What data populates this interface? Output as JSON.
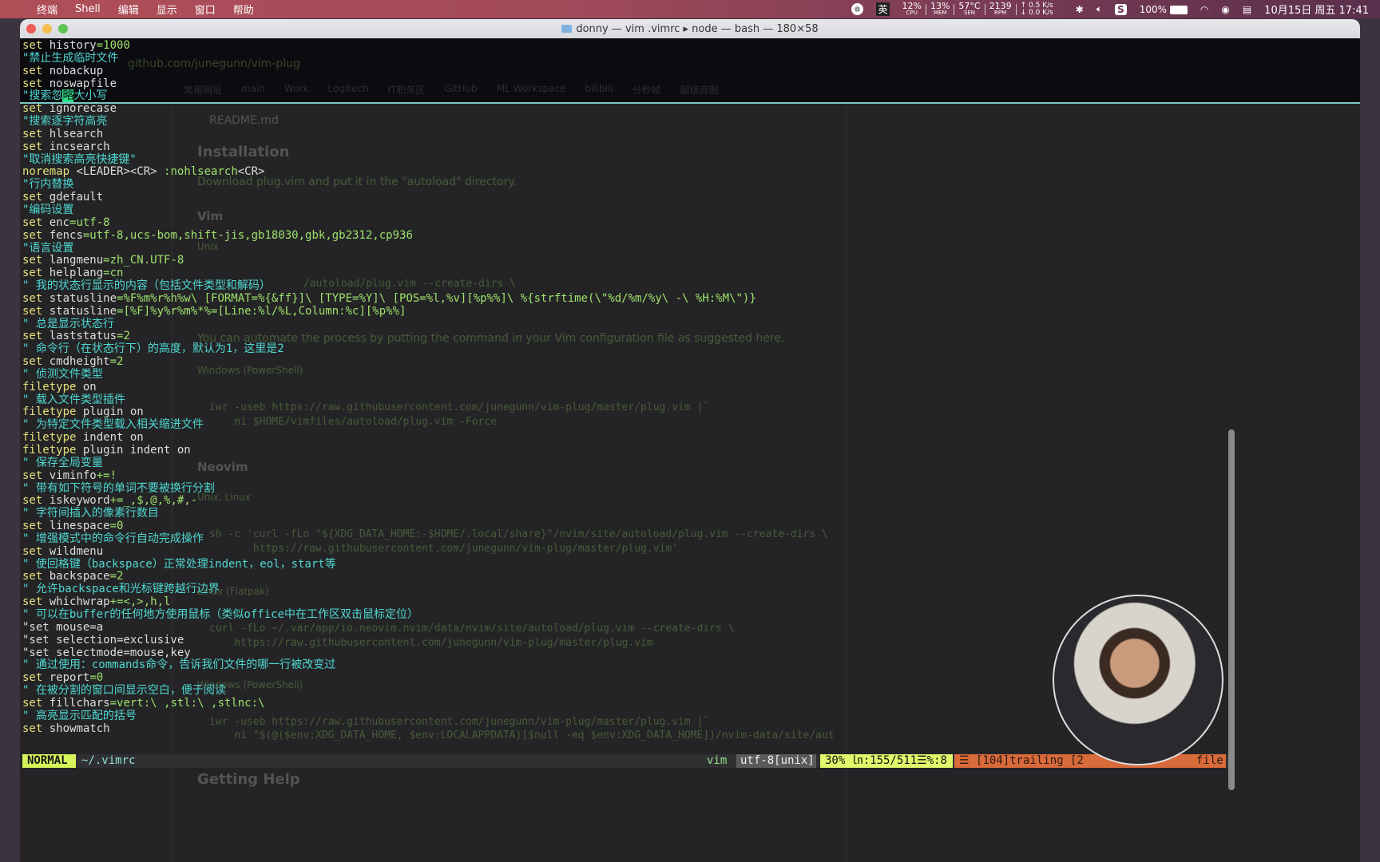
{
  "menubar": {
    "apple": "",
    "items": [
      "终端",
      "Shell",
      "编辑",
      "显示",
      "窗口",
      "帮助"
    ],
    "status": {
      "input_method": "英",
      "cpu": "12%",
      "cpu_label": "CPU",
      "mem": "13%",
      "mem_label": "MEM",
      "sen": "57°C",
      "sen_label": "SEN",
      "rpm": "2139",
      "rpm_label": "RPM",
      "up": "↑ 0.5 K/s",
      "down": "↓ 0.0 K/s",
      "battery": "100%",
      "datetime": "10月15日 周五 17:41"
    }
  },
  "window": {
    "title": "donny — vim .vimrc ▸ node — bash — 180×58"
  },
  "colors": {
    "normal_mode": "#d7f55a",
    "progress": "#e2f76a",
    "warning": "#d96a3a",
    "comment": "#4fd8d2",
    "keyword": "#e6e07c",
    "value": "#9fe36b"
  },
  "background_browser": {
    "url": "github.com/junegunn/vim-plug",
    "bookmarks": [
      "常用网址",
      "main",
      "Work",
      "Logitech",
      "IT职务区",
      "GitHub",
      "ML Workspace",
      "bilibili",
      "分秒帧",
      "超级商图"
    ],
    "readme_title": "README.md",
    "installation": "Installation",
    "download_text": "Download plug.vim and put it in the \"autoload\" directory.",
    "vim": "Vim",
    "unix": "Unix",
    "code1": "/autoload/plug.vim --create-dirs \\",
    "automate": "You can automate the process by putting the command in your Vim configuration file as suggested here.",
    "windows1": "Windows (PowerShell)",
    "code2": "iwr -useb https://raw.githubusercontent.com/junegunn/vim-plug/master/plug.vim |`",
    "code3": "    ni $HOME/vimfiles/autoload/plug.vim -Force",
    "neovim": "Neovim",
    "unix_linux": "Unix, Linux",
    "code4": "sh -c 'curl -fLo \"${XDG_DATA_HOME:-$HOME/.local/share}\"/nvim/site/autoload/plug.vim --create-dirs \\",
    "code5": "       https://raw.githubusercontent.com/junegunn/vim-plug/master/plug.vim'",
    "flatpak": "Linux (Flatpak)",
    "code6": "curl -fLo ~/.var/app/io.neovim.nvim/data/nvim/site/autoload/plug.vim --create-dirs \\",
    "code7": "    https://raw.githubusercontent.com/junegunn/vim-plug/master/plug.vim",
    "windows2": "Windows (PowerShell)",
    "code8": "iwr -useb https://raw.githubusercontent.com/junegunn/vim-plug/master/plug.vim |`",
    "code9": "    ni \"$(@($env:XDG_DATA_HOME, $env:LOCALAPPDATA)[$null -eq $env:XDG_DATA_HOME])/nvim-data/site/aut",
    "getting_help": "Getting Help"
  },
  "vim": {
    "lines": [
      [
        [
          "k",
          "set"
        ],
        [
          "o",
          " history"
        ],
        [
          "v",
          "=1000"
        ]
      ],
      [
        [
          "c",
          "\"禁止生成临时文件"
        ]
      ],
      [
        [
          "k",
          "set"
        ],
        [
          "o",
          " nobackup"
        ]
      ],
      [
        [
          "k",
          "set"
        ],
        [
          "o",
          " noswapfile"
        ]
      ],
      [
        [
          "c",
          "\"搜索忽"
        ],
        [
          "cur",
          "略"
        ],
        [
          "c",
          "大小写"
        ]
      ],
      [
        [
          "k",
          "set"
        ],
        [
          "o",
          " ignorecase"
        ]
      ],
      [
        [
          "c",
          "\"搜索逐字符高亮"
        ]
      ],
      [
        [
          "k",
          "set"
        ],
        [
          "o",
          " hlsearch"
        ]
      ],
      [
        [
          "k",
          "set"
        ],
        [
          "o",
          " incsearch"
        ]
      ],
      [
        [
          "c",
          "\"取消搜索高亮快捷键\""
        ]
      ],
      [
        [
          "k",
          "noremap"
        ],
        [
          "o",
          " <LEADER><CR> "
        ],
        [
          "g",
          ":nohlsearch"
        ],
        [
          "o",
          "<CR>"
        ]
      ],
      [
        [
          "c",
          "\"行内替换"
        ]
      ],
      [
        [
          "k",
          "set"
        ],
        [
          "o",
          " gdefault"
        ]
      ],
      [
        [
          "c",
          "\"编码设置"
        ]
      ],
      [
        [
          "k",
          "set"
        ],
        [
          "o",
          " enc"
        ],
        [
          "v",
          "=utf-8"
        ]
      ],
      [
        [
          "k",
          "set"
        ],
        [
          "o",
          " fencs"
        ],
        [
          "v",
          "=utf-8,ucs-bom,shift-jis,gb18030,gbk,gb2312,cp936"
        ]
      ],
      [
        [
          "c",
          "\"语言设置"
        ]
      ],
      [
        [
          "k",
          "set"
        ],
        [
          "o",
          " langmenu"
        ],
        [
          "v",
          "=zh_CN.UTF-8"
        ]
      ],
      [
        [
          "k",
          "set"
        ],
        [
          "o",
          " helplang"
        ],
        [
          "v",
          "=cn"
        ]
      ],
      [
        [
          "c",
          "\" 我的状态行显示的内容（包括文件类型和解码）"
        ]
      ],
      [
        [
          "k",
          "set"
        ],
        [
          "o",
          " statusline"
        ],
        [
          "v",
          "=%F%m%r%h%w\\ [FORMAT=%{&ff}]\\ [TYPE=%Y]\\ [POS=%l,%v][%p%%]\\ %{strftime(\\\"%d/%m/%y\\ -\\ %H:%M\\\")}"
        ]
      ],
      [
        [
          "k",
          "set"
        ],
        [
          "o",
          " statusline"
        ],
        [
          "v",
          "=[%F]%y%r%m%*%=[Line:%l/%L,Column:%c][%p%%]"
        ]
      ],
      [
        [
          "c",
          "\" 总是显示状态行"
        ]
      ],
      [
        [
          "k",
          "set"
        ],
        [
          "o",
          " laststatus"
        ],
        [
          "v",
          "=2"
        ]
      ],
      [
        [
          "c",
          "\" 命令行（在状态行下）的高度，默认为1，这里是2"
        ]
      ],
      [
        [
          "k",
          "set"
        ],
        [
          "o",
          " cmdheight"
        ],
        [
          "v",
          "=2"
        ]
      ],
      [
        [
          "c",
          "\" 侦测文件类型"
        ]
      ],
      [
        [
          "k",
          "filetype"
        ],
        [
          "o",
          " on"
        ]
      ],
      [
        [
          "c",
          "\" 载入文件类型插件"
        ]
      ],
      [
        [
          "k",
          "filetype"
        ],
        [
          "o",
          " plugin on"
        ]
      ],
      [
        [
          "c",
          "\" 为特定文件类型载入相关缩进文件"
        ]
      ],
      [
        [
          "k",
          "filetype"
        ],
        [
          "o",
          " indent on"
        ]
      ],
      [
        [
          "k",
          "filetype"
        ],
        [
          "o",
          " plugin indent on"
        ]
      ],
      [
        [
          "c",
          "\" 保存全局变量"
        ]
      ],
      [
        [
          "k",
          "set"
        ],
        [
          "o",
          " viminfo"
        ],
        [
          "v",
          "+=!"
        ]
      ],
      [
        [
          "c",
          "\" 带有如下符号的单词不要被换行分割"
        ]
      ],
      [
        [
          "k",
          "set"
        ],
        [
          "o",
          " iskeyword"
        ],
        [
          "v",
          "+=_,$,@,%,#,-"
        ]
      ],
      [
        [
          "c",
          "\" 字符间插入的像素行数目"
        ]
      ],
      [
        [
          "k",
          "set"
        ],
        [
          "o",
          " linespace"
        ],
        [
          "v",
          "=0"
        ]
      ],
      [
        [
          "c",
          "\" 增强模式中的命令行自动完成操作"
        ]
      ],
      [
        [
          "k",
          "set"
        ],
        [
          "o",
          " wildmenu"
        ]
      ],
      [
        [
          "c",
          "\" 使回格键（backspace）正常处理indent，eol，start等"
        ]
      ],
      [
        [
          "k",
          "set"
        ],
        [
          "o",
          " backspace"
        ],
        [
          "v",
          "=2"
        ]
      ],
      [
        [
          "c",
          "\" 允许backspace和光标键跨越行边界"
        ]
      ],
      [
        [
          "k",
          "set"
        ],
        [
          "o",
          " whichwrap"
        ],
        [
          "v",
          "+=<,>,h,l"
        ]
      ],
      [
        [
          "c",
          "\" 可以在buffer的任何地方使用鼠标（类似office中在工作区双击鼠标定位）"
        ]
      ],
      [
        [
          "o",
          "\"set mouse=a"
        ]
      ],
      [
        [
          "o",
          "\"set selection=exclusive"
        ]
      ],
      [
        [
          "o",
          "\"set selectmode=mouse,key"
        ]
      ],
      [
        [
          "c",
          "\" 通过使用：commands命令，告诉我们文件的哪一行被改变过"
        ]
      ],
      [
        [
          "k",
          "set"
        ],
        [
          "o",
          " report"
        ],
        [
          "v",
          "=0"
        ]
      ],
      [
        [
          "c",
          "\" 在被分割的窗口间显示空白，便于阅读"
        ]
      ],
      [
        [
          "k",
          "set"
        ],
        [
          "o",
          " fillchars"
        ],
        [
          "v",
          "=vert:\\ ,stl:\\ ,stlnc:\\"
        ]
      ],
      [
        [
          "c",
          "\" 高亮显示匹配的括号"
        ]
      ],
      [
        [
          "k",
          "set"
        ],
        [
          "o",
          " showmatch"
        ]
      ]
    ]
  },
  "statusline": {
    "mode": "NORMAL",
    "file": "~/.vimrc",
    "filetype": "vim",
    "encoding": "utf-8[unix]",
    "position": "30% ㏑:155/511☰%:8",
    "warning": "☰ [104]trailing [2",
    "warning_tail": "file"
  }
}
